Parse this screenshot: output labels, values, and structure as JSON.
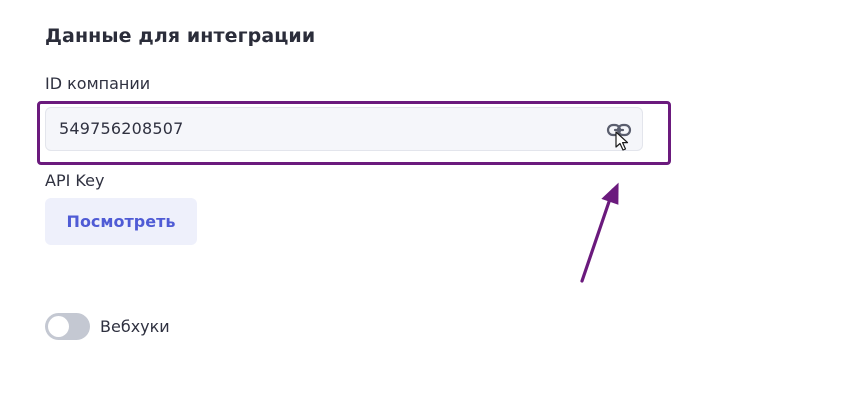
{
  "section": {
    "title": "Данные для интеграции"
  },
  "company_id": {
    "label": "ID компании",
    "value": "549756208507",
    "copy_icon": "link-icon"
  },
  "api_key": {
    "label": "API Key",
    "view_button_label": "Посмотреть"
  },
  "webhooks": {
    "label": "Вебхуки",
    "enabled": false
  },
  "annotation": {
    "highlight_color": "#6b1a7d",
    "arrow_color": "#6b1a7d"
  },
  "colors": {
    "accent": "#4f5bd5",
    "button_bg": "#eef0fb",
    "field_bg": "#f5f6fa",
    "toggle_off": "#c4c8d2"
  }
}
